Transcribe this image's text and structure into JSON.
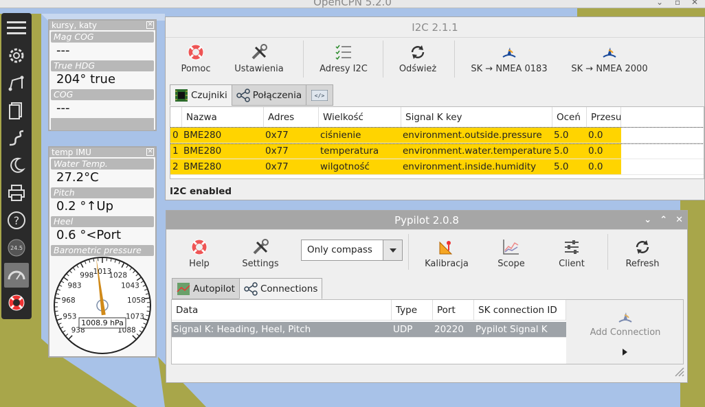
{
  "app": {
    "title": "OpenCPN 5.2.0"
  },
  "dash1": {
    "title": "kursy, katy",
    "items": [
      {
        "label": "Mag COG",
        "value": "---"
      },
      {
        "label": "True HDG",
        "value": "204° true"
      },
      {
        "label": "COG",
        "value": "---"
      }
    ]
  },
  "dash2": {
    "title": "temp IMU",
    "items": [
      {
        "label": "Water Temp.",
        "value": "27.2°C"
      },
      {
        "label": "Pitch",
        "value": "0.2 °↑Up"
      },
      {
        "label": "Heel",
        "value": "0.6 °<Port"
      }
    ],
    "baro_label": "Barometric pressure",
    "gauge": {
      "ticks": [
        "938",
        "953",
        "968",
        "983",
        "998",
        "1013",
        "1028",
        "1043",
        "1058",
        "1073",
        "1088"
      ],
      "readout": "1008.9 hPa",
      "value": 1008.9
    }
  },
  "i2c": {
    "title": "I2C 2.1.1",
    "toolbar": {
      "help": "Pomoc",
      "settings": "Ustawienia",
      "addresses": "Adresy I2C",
      "refresh": "Odśwież",
      "sk0183": "SK → NMEA 0183",
      "sk2000": "SK → NMEA 2000"
    },
    "tabs": [
      "Czujniki",
      "Połączenia"
    ],
    "columns": [
      "Nazwa",
      "Adres",
      "Wielkość",
      "Signal K key",
      "Oceń",
      "Przesu"
    ],
    "rows": [
      {
        "idx": "0",
        "name": "BME280",
        "addr": "0x77",
        "qty": "ciśnienie",
        "key": "environment.outside.pressure",
        "rate": "5.0",
        "offset": "0.0"
      },
      {
        "idx": "1",
        "name": "BME280",
        "addr": "0x77",
        "qty": "temperatura",
        "key": "environment.water.temperature",
        "rate": "5.0",
        "offset": "0.0"
      },
      {
        "idx": "2",
        "name": "BME280",
        "addr": "0x77",
        "qty": "wilgotność",
        "key": "environment.inside.humidity",
        "rate": "5.0",
        "offset": "0.0"
      }
    ],
    "status": "I2C enabled"
  },
  "pypilot": {
    "title": "Pypilot 2.0.8",
    "toolbar": {
      "help": "Help",
      "settings": "Settings",
      "mode": "Only compass",
      "calibration": "Kalibracja",
      "scope": "Scope",
      "client": "Client",
      "refresh": "Refresh"
    },
    "tabs": [
      "Autopilot",
      "Connections"
    ],
    "columns": [
      "Data",
      "Type",
      "Port",
      "SK connection ID"
    ],
    "rows": [
      {
        "data": "Signal K: Heading, Heel, Pitch",
        "type": "UDP",
        "port": "20220",
        "id": "Pypilot Signal K"
      }
    ],
    "add_connection": "Add Connection"
  },
  "colors": {
    "highlight": "#ffd400",
    "selection": "#9ea3a8",
    "toolbar": "#2a2a2a",
    "land": "#a8a64a",
    "water": "#a8c2e8"
  }
}
